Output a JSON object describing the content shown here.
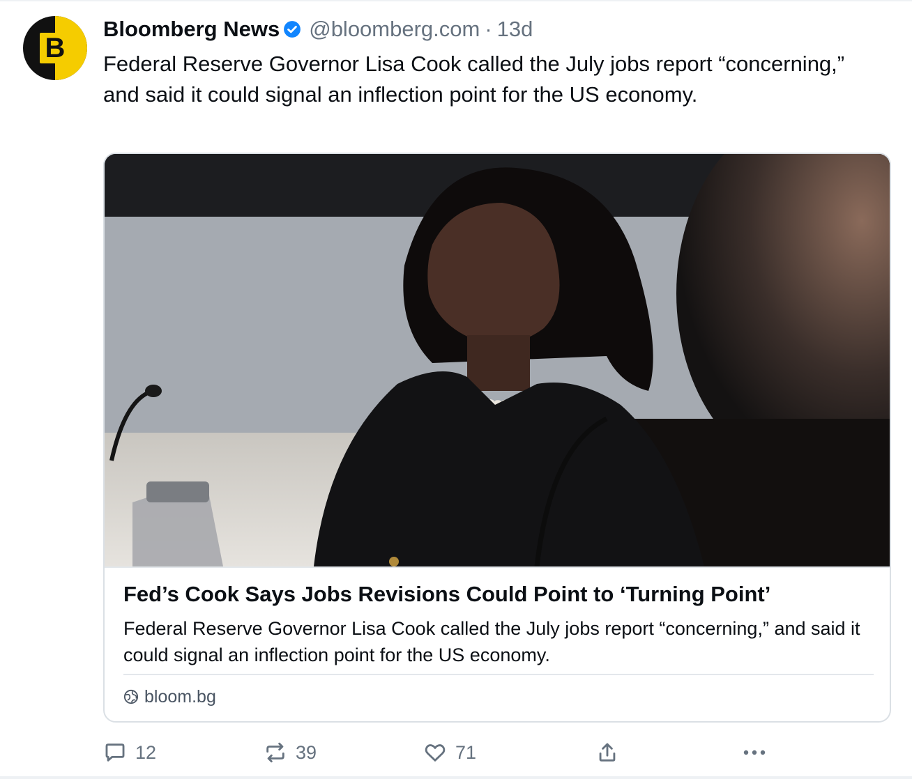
{
  "post": {
    "author_name": "Bloomberg News",
    "verified": true,
    "handle": "@bloomberg.com",
    "separator": "·",
    "time": "13d",
    "avatar_letter": "B",
    "text": "Federal Reserve Governor Lisa Cook called the July jobs report “concerning,” and said it could signal an inflection point for the US economy."
  },
  "card": {
    "title": "Fed’s Cook Says Jobs Revisions Could Point to ‘Turning Point’",
    "description": "Federal Reserve Governor Lisa Cook called the July jobs report “concerning,” and said it could signal an inflection point for the US economy.",
    "domain": "bloom.bg"
  },
  "actions": {
    "replies": "12",
    "reposts": "39",
    "likes": "71"
  },
  "icons": {
    "verified": "verified-badge-icon",
    "reply": "speech-bubble-icon",
    "repost": "repost-arrows-icon",
    "like": "heart-icon",
    "share": "share-upload-icon",
    "more": "ellipsis-icon",
    "domain": "globe-icon"
  },
  "colors": {
    "brand_yellow": "#f5cc00",
    "verified_blue": "#1185fe",
    "muted_text": "#66727f",
    "border": "#dbe0e5"
  }
}
